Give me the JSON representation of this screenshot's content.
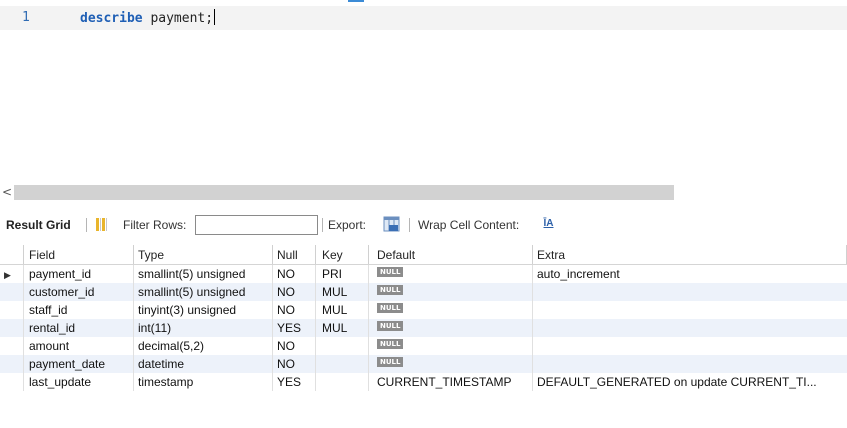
{
  "editor": {
    "line_number": "1",
    "keyword": "describe",
    "table_name": "payment;"
  },
  "scrollbar": {
    "left_arrow": "<"
  },
  "toolbar": {
    "result_grid_label": "Result Grid",
    "filter_label": "Filter Rows:",
    "filter_value": "",
    "export_label": "Export:",
    "wrap_label": "Wrap Cell Content:",
    "wrap_icon_glyph": "ĪA",
    "grid_icon": "grid-icon",
    "export_icon": "export-icon"
  },
  "grid": {
    "columns": [
      "Field",
      "Type",
      "Null",
      "Key",
      "Default",
      "Extra"
    ],
    "null_label": "NULL",
    "selected_marker": "▶",
    "rows": [
      {
        "field": "payment_id",
        "type": "smallint(5) unsigned",
        "null": "NO",
        "key": "PRI",
        "default": null,
        "extra": "auto_increment"
      },
      {
        "field": "customer_id",
        "type": "smallint(5) unsigned",
        "null": "NO",
        "key": "MUL",
        "default": null,
        "extra": ""
      },
      {
        "field": "staff_id",
        "type": "tinyint(3) unsigned",
        "null": "NO",
        "key": "MUL",
        "default": null,
        "extra": ""
      },
      {
        "field": "rental_id",
        "type": "int(11)",
        "null": "YES",
        "key": "MUL",
        "default": null,
        "extra": ""
      },
      {
        "field": "amount",
        "type": "decimal(5,2)",
        "null": "NO",
        "key": "",
        "default": null,
        "extra": ""
      },
      {
        "field": "payment_date",
        "type": "datetime",
        "null": "NO",
        "key": "",
        "default": null,
        "extra": ""
      },
      {
        "field": "last_update",
        "type": "timestamp",
        "null": "YES",
        "key": "",
        "default": "CURRENT_TIMESTAMP",
        "extra": "DEFAULT_GENERATED on update CURRENT_TI..."
      }
    ]
  },
  "colors": {
    "keyword": "#1f5fb5",
    "alt_row": "#edf2fa",
    "null_badge": "#8c8c8c"
  }
}
